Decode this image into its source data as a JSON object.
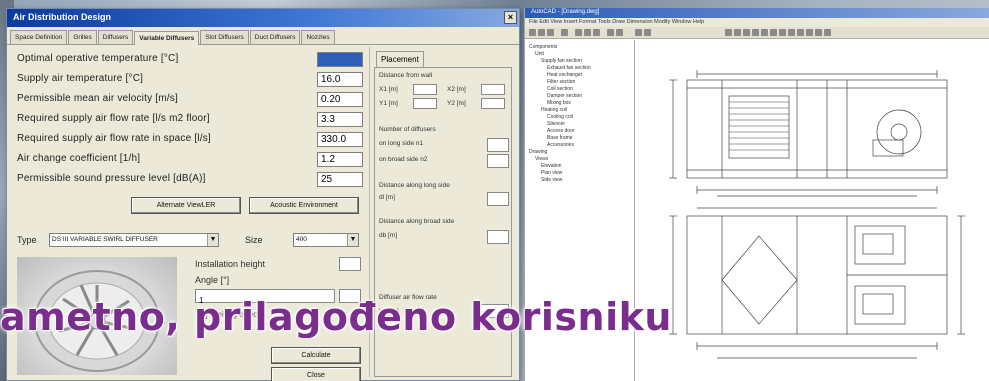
{
  "dialog": {
    "title": "Air Distribution Design",
    "close_label": "×",
    "tabs": [
      "Space Definition",
      "Grilles",
      "Diffusers",
      "Variable Diffusers",
      "Slot Diffusers",
      "Duct Diffusers",
      "Nozzles"
    ],
    "active_tab": "Variable Diffusers",
    "params": [
      {
        "label": "Optimal operative temperature   [°C]",
        "value": "",
        "selected": true
      },
      {
        "label": "Supply air temperature   [°C]",
        "value": "16.0"
      },
      {
        "label": "Permissible mean air velocity   [m/s]",
        "value": "0.20"
      },
      {
        "label": "Required supply air flow rate  [l/s m2 floor]",
        "value": "3.3"
      },
      {
        "label": "Required supply air flow rate in space  [l/s]",
        "value": "330.0"
      },
      {
        "label": "Air change coefficient  [1/h]",
        "value": "1.2"
      },
      {
        "label": "Permissible sound pressure level  [dB(A)]",
        "value": "25"
      }
    ],
    "btn_alternate": "Alternate ViewLER",
    "btn_acoustic": "Acoustic Environment",
    "type_label": "Type",
    "type_value": "DS III  VARIABLE SWIRL DIFFUSER",
    "size_label": "Size",
    "size_value": "400",
    "installation_height_label": "Installation height",
    "angle_label": "Angle  [°]",
    "angle_value": "1",
    "ceiling_effect_label": "Ceiling effect",
    "calculate_label": "Calculate",
    "close_button_label": "Close"
  },
  "placement": {
    "tab_label": "Placement",
    "distance_from_wall": "Distance from wall",
    "x1_label": "X1  [m]",
    "x2_label": "X2  [m]",
    "y1_label": "Y1  [m]",
    "y2_label": "Y2  [m]",
    "number_of_diffusers": "Number of diffusers",
    "on_long_side": "on long side   n1",
    "on_broad_side": "on broad side   n2",
    "distance_long_side": "Distance along long side",
    "dl_label": "dl  [m]",
    "distance_broad_side": "Distance along broad side",
    "db_label": "db  [m]",
    "diffuser_air_flow_rate": "Diffuser air flow rate",
    "vd_label": "Vd  [l/s]"
  },
  "cad": {
    "title": "AutoCAD - [Drawing.dwg]",
    "menu": "File  Edit  View  Insert  Format  Tools  Draw  Dimension  Modify  Window  Help",
    "tree": [
      "Components",
      "Unit",
      "Supply fan section",
      "Exhaust fan section",
      "Heat exchanger",
      "Filter section",
      "Coil section",
      "Damper section",
      "Mixing box",
      "Heating coil",
      "Cooling coil",
      "Silencer",
      "Access door",
      "Base frame",
      "Accessories",
      "Drawing",
      "Views",
      "Elevation",
      "Plan view",
      "Side view"
    ]
  },
  "banner": {
    "text": "ametno, prilagođeno korisniku"
  }
}
